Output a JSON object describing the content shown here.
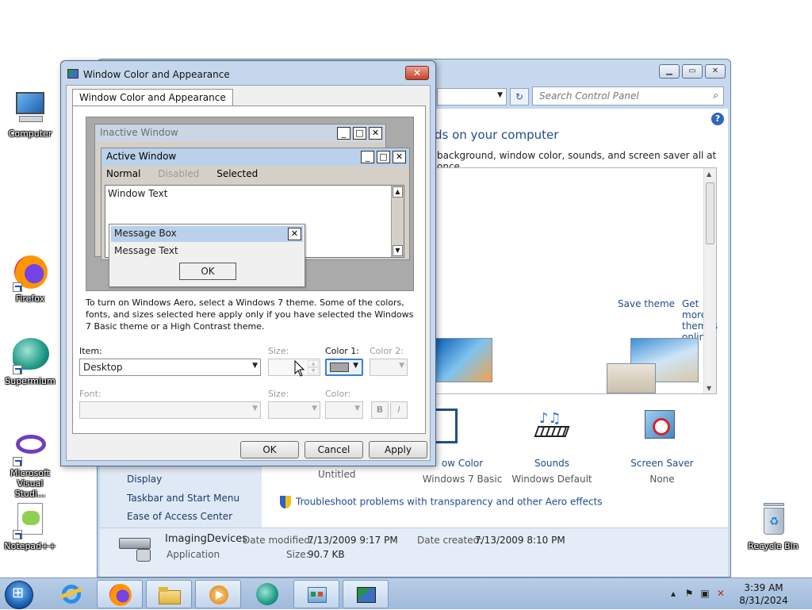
{
  "desktop": {
    "icons": [
      {
        "label": "Computer"
      },
      {
        "label": "Firefox"
      },
      {
        "label": "Supermium"
      },
      {
        "label": "Microsoft Visual Studi..."
      },
      {
        "label": "Notepad++"
      },
      {
        "label": "Recycle Bin"
      }
    ]
  },
  "control_panel": {
    "search_placeholder": "Search Control Panel",
    "heading": "ds on your computer",
    "subheading": "background, window color, sounds, and screen saver all at once.",
    "save_theme": "Save theme",
    "get_more_themes": "Get more themes online",
    "sidebar_links": [
      "Display",
      "Taskbar and Start Menu",
      "Ease of Access Center"
    ],
    "items": [
      {
        "label": "ow Color",
        "sub": "Windows 7 Basic"
      },
      {
        "label": "Sounds",
        "sub": "Windows Default"
      },
      {
        "label": "Screen Saver",
        "sub": "None"
      }
    ],
    "untitled": "Untitled",
    "troubleshoot": "Troubleshoot problems with transparency and other Aero effects",
    "details": {
      "name": "ImagingDevices",
      "type": "Application",
      "date_modified_label": "Date modified:",
      "date_modified": "7/13/2009 9:17 PM",
      "date_created_label": "Date created:",
      "date_created": "7/13/2009 8:10 PM",
      "size_label": "Size:",
      "size": "90.7 KB"
    }
  },
  "dialog": {
    "title": "Window Color and Appearance",
    "tab": "Window Color and Appearance",
    "preview": {
      "inactive_title": "Inactive Window",
      "active_title": "Active Window",
      "menu_normal": "Normal",
      "menu_disabled": "Disabled",
      "menu_selected": "Selected",
      "window_text": "Window Text",
      "msgbox_title": "Message Box",
      "msgbox_text": "Message Text",
      "msgbox_ok": "OK"
    },
    "info_text": "To turn on Windows Aero, select a Windows 7 theme.  Some of the colors, fonts, and sizes selected here apply only if you have selected the Windows 7 Basic theme or a High Contrast theme.",
    "item_label": "Item:",
    "item_value": "Desktop",
    "size_label": "Size:",
    "color1_label": "Color 1:",
    "color2_label": "Color 2:",
    "font_label": "Font:",
    "font_size_label": "Size:",
    "font_color_label": "Color:",
    "bold_label": "B",
    "italic_label": "I",
    "color1_swatch": "#a5a5a5",
    "ok": "OK",
    "cancel": "Cancel",
    "apply": "Apply"
  },
  "taskbar": {
    "time": "3:39 AM",
    "date": "8/31/2024"
  }
}
